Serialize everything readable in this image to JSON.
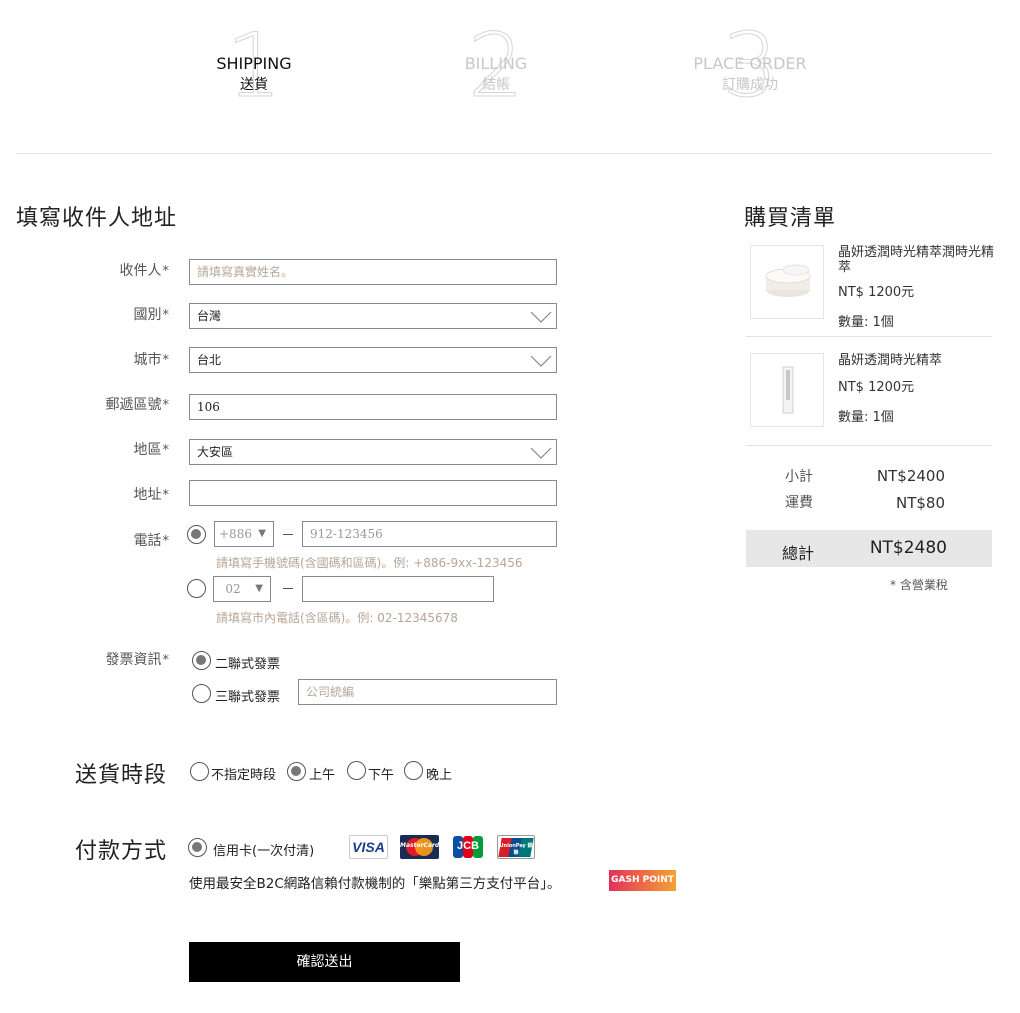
{
  "steps": [
    {
      "num": "1",
      "en": "SHIPPING",
      "zh": "送貨"
    },
    {
      "num": "2",
      "en": "BILLING",
      "zh": "結帳"
    },
    {
      "num": "3",
      "en": "PLACE ORDER",
      "zh": "訂購成功"
    }
  ],
  "form": {
    "title": "填寫收件人地址",
    "recipient": {
      "label": "收件人",
      "placeholder": "請填寫真實姓名。"
    },
    "country": {
      "label": "國別",
      "value": "台灣"
    },
    "city": {
      "label": "城市",
      "value": "台北"
    },
    "zip": {
      "label": "郵遞區號",
      "value": "106"
    },
    "district": {
      "label": "地區",
      "value": "大安區"
    },
    "address": {
      "label": "地址",
      "value": ""
    },
    "phone": {
      "label": "電話",
      "mobile_code": "+886",
      "mobile_placeholder": "912-123456",
      "mobile_hint": "請填寫手機號碼(含國碼和區碼)。例: +886-9xx-123456",
      "landline_code": "02",
      "landline_hint": "請填寫市內電話(含區碼)。例: 02-12345678"
    },
    "invoice": {
      "label": "發票資訊",
      "option1": "二聯式發票",
      "option2": "三聯式發票",
      "tax_placeholder": "公司統編"
    },
    "required_mark": "*"
  },
  "delivery": {
    "title": "送貨時段",
    "options": [
      "不指定時段",
      "上午",
      "下午",
      "晚上"
    ],
    "selected_index": 1
  },
  "payment": {
    "title": "付款方式",
    "option": "信用卡(一次付清)",
    "note": "使用最安全B2C網路信賴付款機制的「樂點第三方支付平台」。",
    "cards": [
      "VISA",
      "MasterCard",
      "JCB",
      "UnionPay 銀聯"
    ],
    "gash": "GASH POINT"
  },
  "submit_label": "確認送出",
  "cart": {
    "title": "購買清單",
    "items": [
      {
        "name": "晶妍透潤時光精萃潤時光精萃",
        "price": "NT$ 1200元",
        "qty": "數量: 1個"
      },
      {
        "name": "晶妍透潤時光精萃",
        "price": "NT$ 1200元",
        "qty": "數量: 1個"
      }
    ],
    "subtotal_label": "小計",
    "subtotal": "NT$2400",
    "shipping_label": "運費",
    "shipping": "NT$80",
    "total_label": "總計",
    "total": "NT$2480",
    "tax_note": "* 含營業稅"
  },
  "colors": {
    "accent": "#000000",
    "hint": "#b8a596",
    "total_bg": "#e7e7e7"
  }
}
